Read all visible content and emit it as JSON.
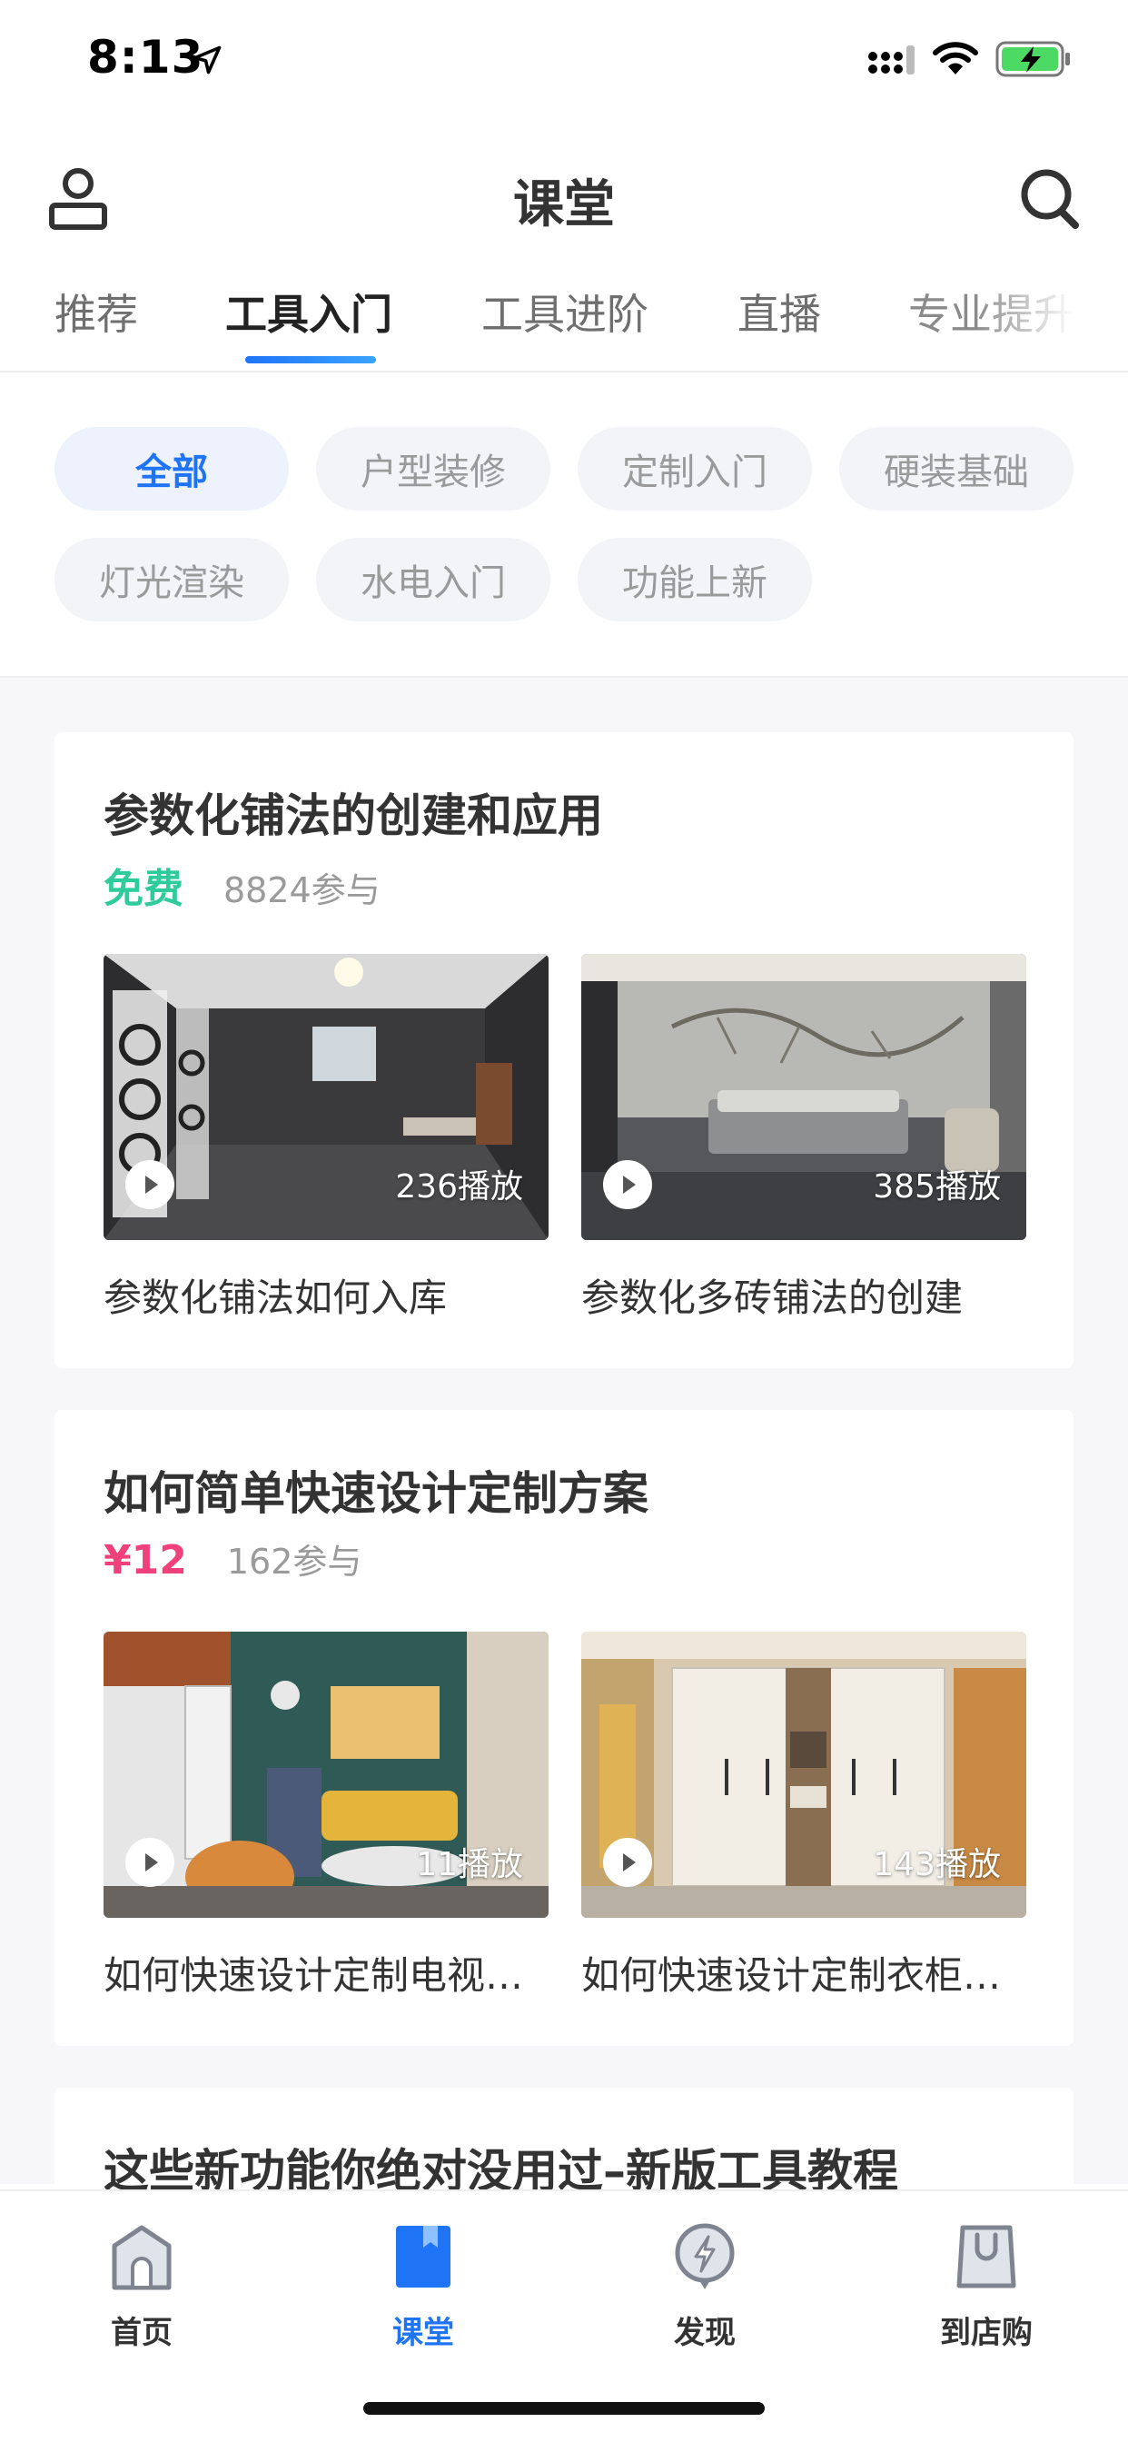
{
  "status_bar": {
    "time": "8:13"
  },
  "header": {
    "title": "课堂"
  },
  "tabs": [
    {
      "label": "推荐"
    },
    {
      "label": "工具入门"
    },
    {
      "label": "工具进阶"
    },
    {
      "label": "直播"
    },
    {
      "label": "专业提升"
    }
  ],
  "active_tab": "工具入门",
  "filters": [
    {
      "label": "全部"
    },
    {
      "label": "户型装修"
    },
    {
      "label": "定制入门"
    },
    {
      "label": "硬装基础"
    },
    {
      "label": "灯光渲染"
    },
    {
      "label": "水电入门"
    },
    {
      "label": "功能上新"
    }
  ],
  "active_filter": "全部",
  "courses": [
    {
      "title": "参数化铺法的创建和应用",
      "price": "免费",
      "price_color": "#2ecc9b",
      "participants": "8824参与",
      "lessons": [
        {
          "title": "参数化铺法如何入库",
          "plays": "236播放"
        },
        {
          "title": "参数化多砖铺法的创建",
          "plays": "385播放"
        }
      ]
    },
    {
      "title": "如何简单快速设计定制方案",
      "price": "¥12",
      "price_color": "#f0417a",
      "participants": "162参与",
      "lessons": [
        {
          "title": "如何快速设计定制电视…",
          "plays": "11播放"
        },
        {
          "title": "如何快速设计定制衣柜…",
          "plays": "143播放"
        }
      ]
    },
    {
      "title": "这些新功能你绝对没用过–新版工具教程"
    }
  ],
  "bottom_nav": [
    {
      "label": "首页",
      "icon": "home-icon"
    },
    {
      "label": "课堂",
      "icon": "classroom-icon"
    },
    {
      "label": "发现",
      "icon": "discover-icon"
    },
    {
      "label": "到店购",
      "icon": "store-icon"
    }
  ],
  "colors": {
    "accent": "#1f74f5",
    "free": "#2ecc9b",
    "paid": "#f0417a"
  }
}
